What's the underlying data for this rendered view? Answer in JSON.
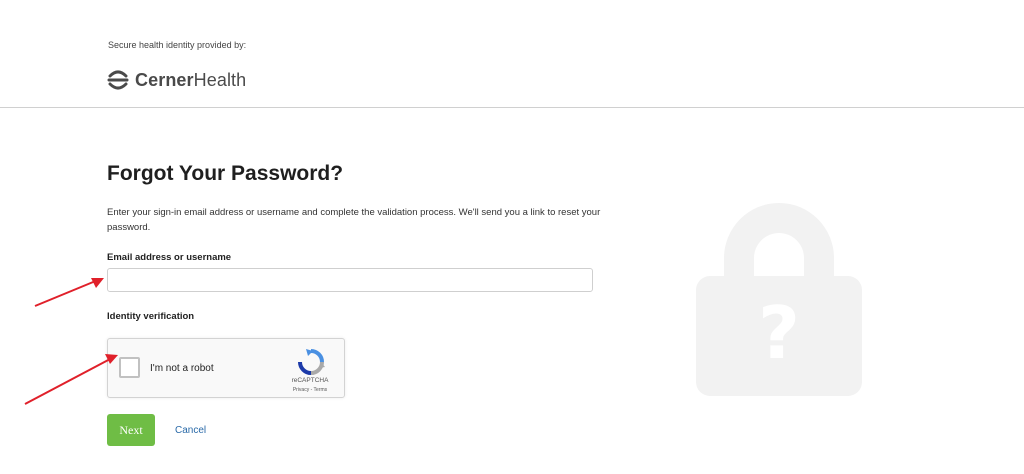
{
  "header": {
    "provided_by": "Secure health identity provided by:",
    "logo": {
      "brand_bold": "Cerner",
      "brand_regular": "Health",
      "icon": "cerner-logo-icon"
    }
  },
  "form": {
    "title": "Forgot Your Password?",
    "description": "Enter your sign-in email address or username and complete the validation process. We'll send you a link to reset your password.",
    "email_label": "Email address or username",
    "email_value": "",
    "email_placeholder": "",
    "identity_label": "Identity verification",
    "recaptcha": {
      "checkbox_label": "I'm not a robot",
      "brand": "reCAPTCHA",
      "links": "Privacy - Terms",
      "checked": false
    },
    "next_label": "Next",
    "cancel_label": "Cancel"
  },
  "illustration": {
    "icon": "lock-question-icon"
  },
  "annotations": {
    "arrow_color": "#e0202a"
  },
  "colors": {
    "next_button": "#6fbd45",
    "cancel_link": "#2a6aa8",
    "lock_fill": "#f2f2f2"
  }
}
